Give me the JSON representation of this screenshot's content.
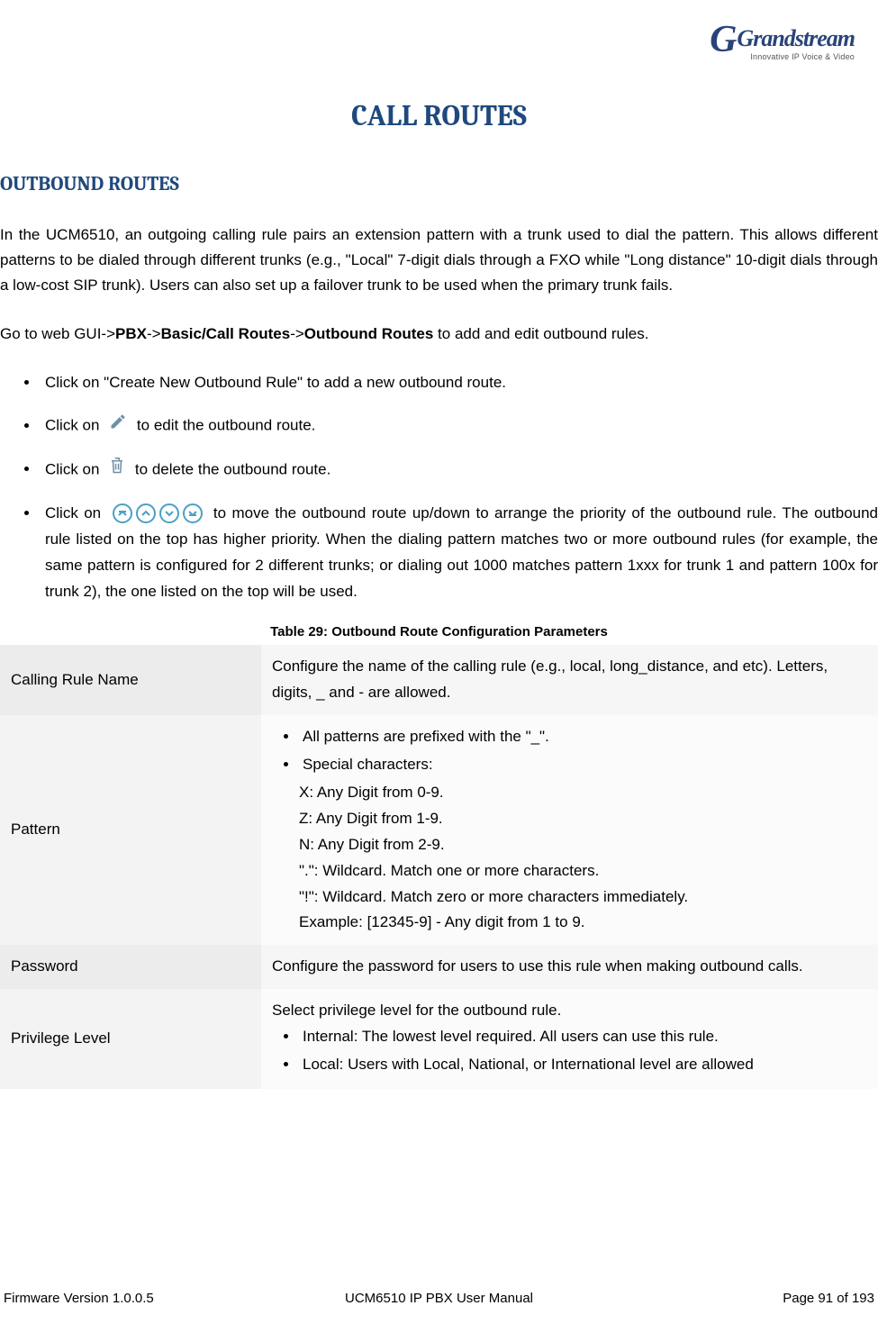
{
  "logo": {
    "name": "Grandstream",
    "tag": "Innovative IP Voice & Video"
  },
  "title": "CALL ROUTES",
  "subheading": "OUTBOUND ROUTES",
  "p1": "In the UCM6510, an outgoing calling rule pairs an extension pattern with a trunk used to dial the pattern. This allows different patterns to be dialed through different trunks (e.g., \"Local\" 7-digit dials through a FXO while \"Long distance\" 10-digit dials through a low-cost SIP trunk). Users can also set up a failover trunk to be used when the primary trunk fails.",
  "p2_pre": "Go to web GUI->",
  "p2_b1": "PBX",
  "p2_sep1": "->",
  "p2_b2": "Basic/Call Routes",
  "p2_sep2": "->",
  "p2_b3": "Outbound Routes",
  "p2_post": " to add and edit outbound rules.",
  "bullets": {
    "b1": "Click on \"Create New Outbound Rule\" to add a new outbound route.",
    "b2_pre": "Click on ",
    "b2_post": " to edit the outbound route.",
    "b3_pre": "Click on ",
    "b3_post": " to delete the outbound route.",
    "b4_pre": "Click on ",
    "b4_post": " to move the outbound route up/down to arrange the priority of the outbound rule. The outbound rule listed on the top has higher priority. When the dialing pattern matches two or more outbound rules (for example, the same pattern is configured for 2 different trunks; or dialing out 1000 matches pattern 1xxx for trunk 1 and pattern 100x for trunk 2), the one listed on the top will be used."
  },
  "table_caption": "Table 29: Outbound Route Configuration Parameters",
  "table": {
    "r1": {
      "label": "Calling Rule Name",
      "text": "Configure the name of the calling rule (e.g., local, long_distance, and etc). Letters, digits, _ and - are allowed."
    },
    "r2": {
      "label": "Pattern",
      "li1": "All patterns are prefixed with the \"_\".",
      "li2": "Special characters:",
      "l1": "X: Any Digit from 0-9.",
      "l2": "Z: Any Digit from 1-9.",
      "l3": "N: Any Digit from 2-9.",
      "l4": "\".\": Wildcard. Match one or more characters.",
      "l5": "\"!\": Wildcard. Match zero or more characters immediately.",
      "l6": "Example: [12345-9] - Any digit from 1 to 9."
    },
    "r3": {
      "label": "Password",
      "text": "Configure the password for users to use this rule when making outbound calls."
    },
    "r4": {
      "label": "Privilege Level",
      "intro": "Select privilege level for the outbound rule.",
      "li1": "Internal: The lowest level required. All users can use this rule.",
      "li2": "Local: Users with Local, National, or International level are allowed"
    }
  },
  "footer": {
    "left": "Firmware Version 1.0.0.5",
    "center": "UCM6510 IP PBX User Manual",
    "right": "Page 91 of 193"
  }
}
